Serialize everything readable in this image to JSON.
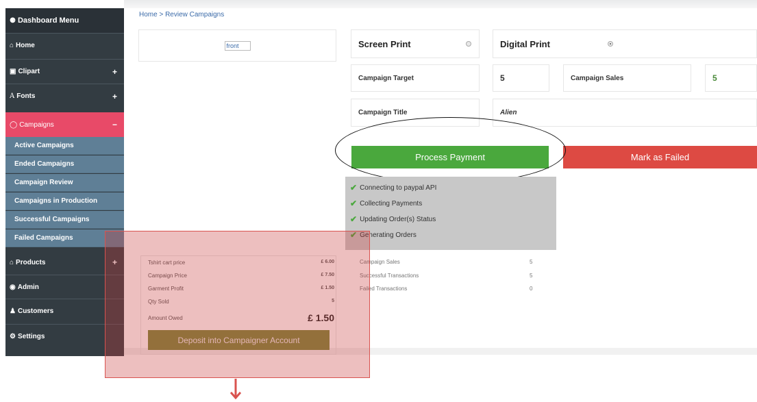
{
  "sidebar": {
    "header": "Dashboard Menu",
    "home": "Home",
    "clipart": "Clipart",
    "fonts": "Fonts",
    "campaigns": "Campaigns",
    "plus": "+",
    "minus": "−",
    "sub_items": [
      "Active Campaigns",
      "Ended Campaigns",
      "Campaign Review",
      "Campaigns in Production",
      "Successful Campaigns",
      "Failed Campaigns"
    ],
    "products": "Products",
    "admin": "Admin",
    "customers": "Customers",
    "settings": "Settings"
  },
  "breadcrumb": "Home > Review Campaigns",
  "front_image_alt": "front",
  "print": {
    "screen": "Screen Print",
    "digital": "Digital Print",
    "selected": "digital"
  },
  "campaign": {
    "target_label": "Campaign Target",
    "target_value": "5",
    "sales_label": "Campaign Sales",
    "sales_value": "5",
    "title_label": "Campaign Title",
    "title_value": "Alien"
  },
  "actions": {
    "process": "Process Payment",
    "fail": "Mark as Failed"
  },
  "status_lines": [
    "Connecting to paypal API",
    "Collecting Payments",
    "Updating Order(s) Status",
    "Generating Orders"
  ],
  "stats": [
    {
      "label": "Campaign Sales",
      "value": "5"
    },
    {
      "label": "Successful Transactions",
      "value": "5"
    },
    {
      "label": "Failed Transactions",
      "value": "0"
    }
  ],
  "payout": {
    "rows": [
      {
        "label": "Tshirt cart price",
        "value": "£ 6.00"
      },
      {
        "label": "Campaign Price",
        "value": "£ 7.50"
      },
      {
        "label": "Garment Profit",
        "value": "£ 1.50"
      },
      {
        "label": "Qty Sold",
        "value": "5"
      }
    ],
    "amount_label": "Amount Owed",
    "amount_value": "£ 1.50",
    "deposit": "Deposit into Campaigner Account"
  },
  "colors": {
    "sidebar_bg": "#333c42",
    "active_menu": "#e84a68",
    "submenu_bg": "#5f7f96",
    "process_green": "#4aa83d",
    "fail_red": "#dd4a43",
    "highlight": "#d9534f"
  },
  "icons": [
    "dashboard-icon",
    "home-icon",
    "image-icon",
    "font-icon",
    "circle-icon",
    "eye-icon",
    "users-icon",
    "gear-icon",
    "check-icon",
    "arrow-down-icon"
  ]
}
